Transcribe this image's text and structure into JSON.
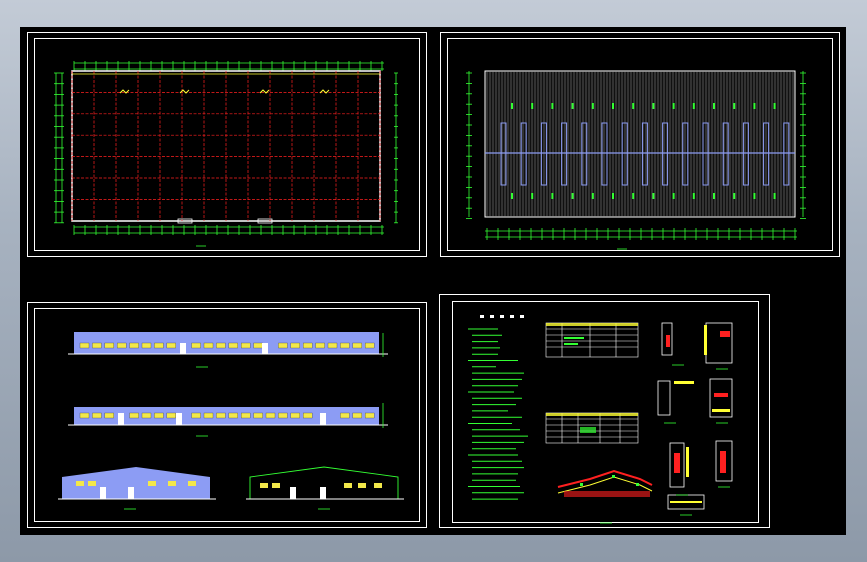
{
  "app": {
    "name": ""
  },
  "sheets": [
    {
      "id": "plan-1",
      "title": ""
    },
    {
      "id": "plan-2",
      "title": ""
    },
    {
      "id": "elevations",
      "title": ""
    },
    {
      "id": "details",
      "title": ""
    }
  ],
  "colors": {
    "background": "#000000",
    "frame": "#ffffff",
    "grid_red": "#ff2020",
    "dim_green": "#33ff33",
    "wall_yellow": "#ffff33",
    "roof_blue": "#8c9cf4",
    "window_yellow": "#f2e84a"
  }
}
